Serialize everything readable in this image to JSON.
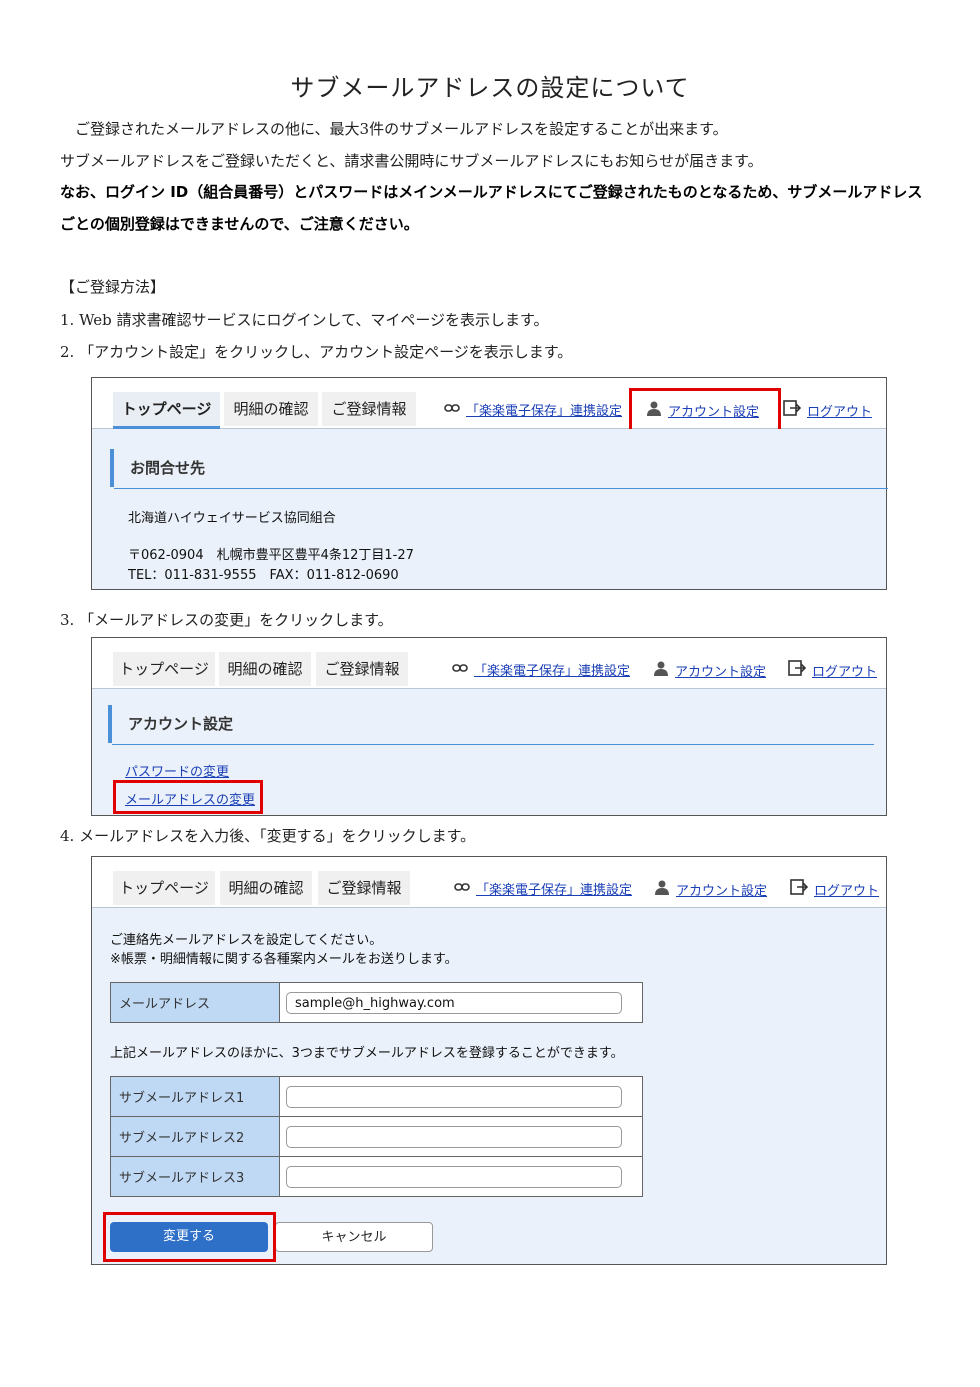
{
  "doc": {
    "title": "サブメールアドレスの設定について",
    "intro": [
      "ご登録されたメールアドレスの他に、最大3件のサブメールアドレスを設定することが出来ます。",
      "サブメールアドレスをご登録いただくと、請求書公開時にサブメールアドレスにもお知らせが届きます。"
    ],
    "notice": [
      "なお、ログイン ID（組合員番号）とパスワードはメインメールアドレスにてご登録されたものとなるため、サブメールアドレス",
      "ごとの個別登録はできませんので、ご注意ください。"
    ],
    "method_heading": "【ご登録方法】",
    "steps": [
      "1.  Web 請求書確認サービスにログインして、マイページを表示します。",
      "2.  「アカウント設定」をクリックし、アカウント設定ページを表示します。",
      "3.  「メールアドレスの変更」をクリックします。",
      "4.  メールアドレスを入力後、「変更する」をクリックします。"
    ]
  },
  "nav": {
    "top": "トップページ",
    "meisai": "明細の確認",
    "touroku": "ご登録情報",
    "rakuraku": "「楽楽電子保存」連携設定",
    "account": "アカウント設定",
    "logout": "ログアウト"
  },
  "shot1": {
    "section": "お問合せ先",
    "org": "北海道ハイウェイサービス協同組合",
    "address": "〒062-0904　札幌市豊平区豊平4条12丁目1-27",
    "tel": "TEL：011-831-9555　FAX：011-812-0690"
  },
  "shot2": {
    "section": "アカウント設定",
    "password_link": "パスワードの変更",
    "mail_link": "メールアドレスの変更"
  },
  "shot3": {
    "instruction1": "ご連絡先メールアドレスを設定してください。",
    "instruction2": "※帳票・明細情報に関する各種案内メールをお送りします。",
    "mail_label": "メールアドレス",
    "mail_value": "sample@h_highway.com",
    "sub_note": "上記メールアドレスのほかに、3つまでサブメールアドレスを登録することができます。",
    "sub1_label": "サブメールアドレス1",
    "sub2_label": "サブメールアドレス2",
    "sub3_label": "サブメールアドレス3",
    "sub1_value": "",
    "sub2_value": "",
    "sub3_value": "",
    "submit": "変更する",
    "cancel": "キャンセル"
  },
  "colors": {
    "highlight": "#e00000",
    "accent": "#4a8fd8",
    "link": "#1a3fb6",
    "primary_button": "#2e6fc8"
  },
  "icons": {
    "rakuraku": "link-icon",
    "account": "person-icon",
    "logout": "logout-icon"
  }
}
